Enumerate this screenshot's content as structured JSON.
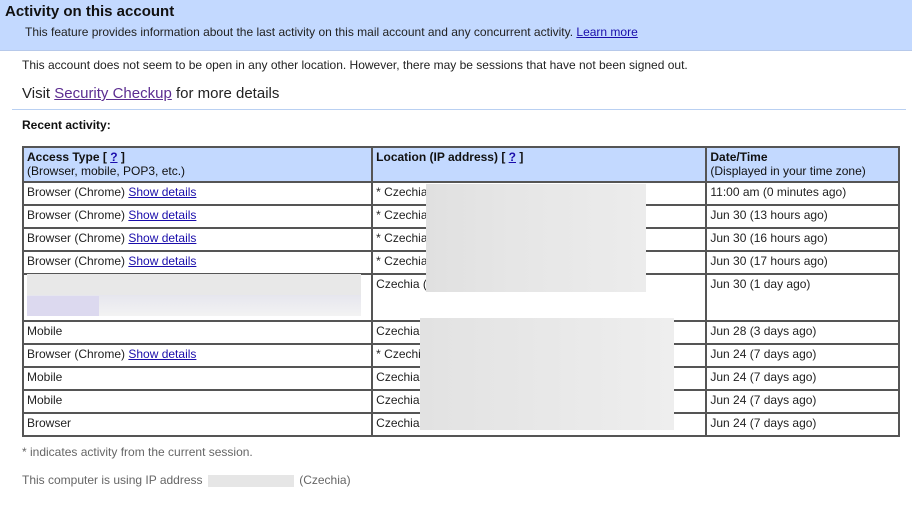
{
  "header": {
    "title": "Activity on this account",
    "description": "This feature provides information about the last activity on this mail account and any concurrent activity.",
    "learn_more": "Learn more"
  },
  "notice": "This account does not seem to be open in any other location. However, there may be sessions that have not been signed out.",
  "visit": {
    "prefix": "Visit",
    "link": "Security Checkup",
    "suffix": "for more details"
  },
  "recent_label": "Recent activity:",
  "table": {
    "col1_title": "Access Type",
    "col1_sub": "(Browser, mobile, POP3, etc.)",
    "col2_title": "Location (IP address)",
    "col3_title": "Date/Time",
    "col3_sub": "(Displayed in your time zone)",
    "help_link": "?",
    "show_details": "Show details",
    "rows": [
      {
        "access": "Browser (Chrome)",
        "details": true,
        "location": "* Czechia",
        "date": "11:00 am (0 minutes ago)"
      },
      {
        "access": "Browser (Chrome)",
        "details": true,
        "location": "* Czechia",
        "date": "Jun 30 (13 hours ago)"
      },
      {
        "access": "Browser (Chrome)",
        "details": true,
        "location": "* Czechia",
        "date": "Jun 30 (16 hours ago)"
      },
      {
        "access": "Browser (Chrome)",
        "details": true,
        "location": "* Czechia",
        "date": "Jun 30 (17 hours ago)"
      },
      {
        "access": "",
        "details": false,
        "location": "Czechia (",
        "date": "Jun 30 (1 day ago)"
      },
      {
        "access": "Mobile",
        "details": false,
        "location": "Czechia",
        "date": "Jun 28 (3 days ago)"
      },
      {
        "access": "Browser (Chrome)",
        "details": true,
        "location": "* Czechi",
        "date": "Jun 24 (7 days ago)"
      },
      {
        "access": "Mobile",
        "details": false,
        "location": "Czechia",
        "date": "Jun 24 (7 days ago)"
      },
      {
        "access": "Mobile",
        "details": false,
        "location": "Czechia",
        "date": "Jun 24 (7 days ago)"
      },
      {
        "access": "Browser",
        "details": false,
        "location": "Czechia",
        "date": "Jun 24 (7 days ago)"
      }
    ]
  },
  "footnote": "* indicates activity from the current session.",
  "ip_line": {
    "prefix": "This computer is using IP address",
    "suffix": "(Czechia)"
  }
}
